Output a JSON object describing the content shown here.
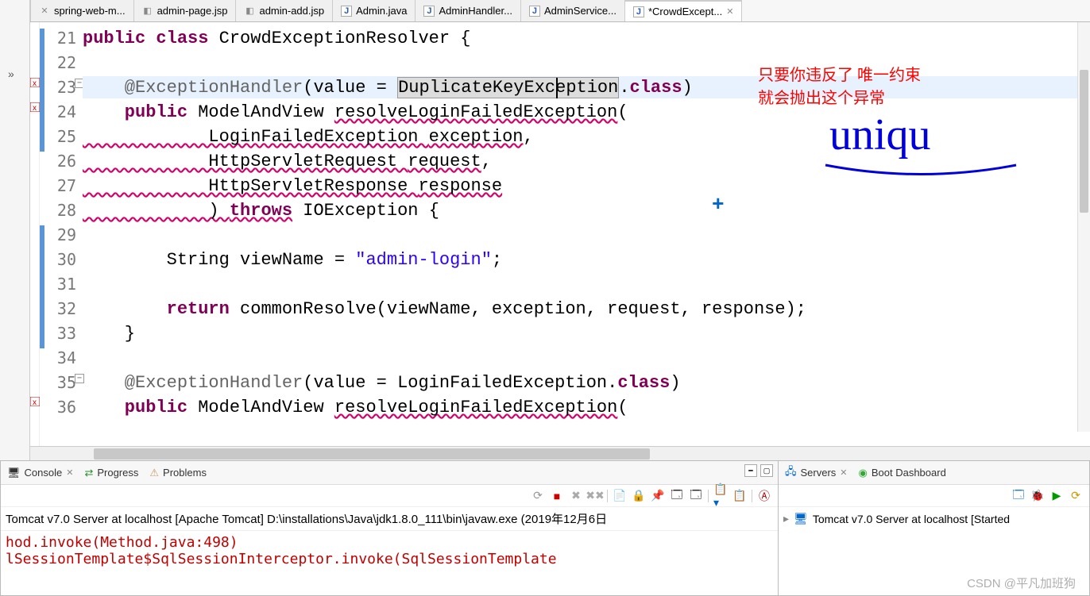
{
  "tabs": [
    {
      "label": "spring-web-m...",
      "icon": "xml"
    },
    {
      "label": "admin-page.jsp",
      "icon": "jsp"
    },
    {
      "label": "admin-add.jsp",
      "icon": "jsp"
    },
    {
      "label": "Admin.java",
      "icon": "java"
    },
    {
      "label": "AdminHandler...",
      "icon": "java"
    },
    {
      "label": "AdminService...",
      "icon": "java"
    },
    {
      "label": "*CrowdExcept...",
      "icon": "java",
      "active": true
    }
  ],
  "lines": {
    "21": "21",
    "22": "22",
    "23": "23",
    "24": "24",
    "25": "25",
    "26": "26",
    "27": "27",
    "28": "28",
    "29": "29",
    "30": "30",
    "31": "31",
    "32": "32",
    "33": "33",
    "34": "34",
    "35": "35",
    "36": "36"
  },
  "code": {
    "l21a": "public",
    "l21b": " class",
    "l21c": " CrowdExceptionResolver {",
    "l23a": "    @ExceptionHandler",
    "l23b": "(value = ",
    "l23c": "DuplicateKeyException",
    "l23d": ".",
    "l23e": "class",
    "l23f": ")",
    "l24a": "    public",
    "l24b": " ModelAndView ",
    "l24c": "resolveLoginFailedException",
    "l24d": "(",
    "l25a": "            LoginFailedException ",
    "l25b": "exception",
    "l25c": ",",
    "l26a": "            HttpServletRequest ",
    "l26b": "request",
    "l26c": ",",
    "l27a": "            HttpServletResponse ",
    "l27b": "response",
    "l28a": "            ) ",
    "l28b": "throws",
    "l28c": " IOException {",
    "l30a": "        String viewName = ",
    "l30b": "\"admin-login\"",
    "l30c": ";",
    "l32a": "        return",
    "l32b": " commonResolve(viewName, exception, request, response);",
    "l33": "    }",
    "l35a": "    @ExceptionHandler",
    "l35b": "(value = LoginFailedException.",
    "l35c": "class",
    "l35d": ")",
    "l36a": "    public",
    "l36b": " ModelAndView ",
    "l36c": "resolveLoginFailedException",
    "l36d": "("
  },
  "annotations": {
    "note1": "只要你违反了 唯一约束",
    "note2": "就会抛出这个异常",
    "big": "uniqu",
    "plus": "+"
  },
  "bottom": {
    "console_tab": "Console",
    "progress_tab": "Progress",
    "problems_tab": "Problems",
    "console_title": "Tomcat v7.0 Server at localhost [Apache Tomcat] D:\\installations\\Java\\jdk1.8.0_111\\bin\\javaw.exe (2019年12月6日 ",
    "con1": "hod.invoke(Method.java:498)",
    "con2": "lSessionTemplate$SqlSessionInterceptor.invoke(SqlSessionTemplate",
    "servers_tab": "Servers",
    "boot_tab": "Boot Dashboard",
    "server_row": "Tomcat v7.0 Server at localhost  [Started"
  },
  "watermark": "CSDN @平凡加班狗"
}
